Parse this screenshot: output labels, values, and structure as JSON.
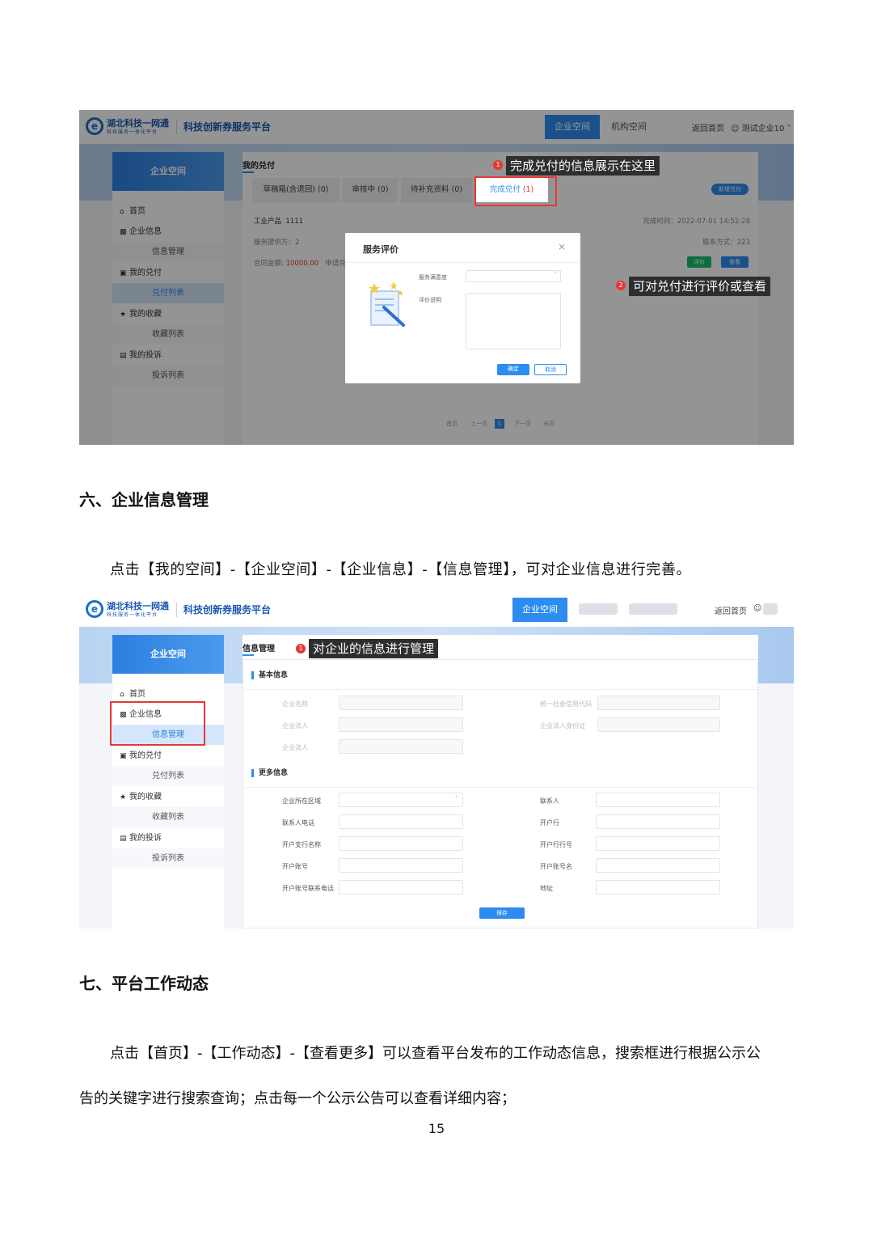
{
  "screenshot1": {
    "logo_title": "湖北科技一网通",
    "logo_sub": "科技服务一体化平台",
    "platform_title": "科技创新券服务平台",
    "top_tabs": [
      "企业空间",
      "机构空间"
    ],
    "top_links": [
      "返回首页",
      "测试企业10"
    ],
    "sidebar": {
      "head": "企业空间",
      "items": [
        {
          "label": "首页",
          "icon": "home-icon"
        },
        {
          "label": "企业信息",
          "icon": "chart-icon"
        },
        {
          "label": "信息管理",
          "sub": true
        },
        {
          "label": "我的兑付",
          "icon": "square-icon"
        },
        {
          "label": "兑付列表",
          "sub": true
        },
        {
          "label": "我的收藏",
          "icon": "star-icon"
        },
        {
          "label": "收藏列表",
          "sub": true
        },
        {
          "label": "我的投诉",
          "icon": "doc-icon"
        },
        {
          "label": "投诉列表",
          "sub": true
        }
      ]
    },
    "page_title": "我的兑付",
    "tabs": [
      "草稿箱(含退回)",
      "审核中",
      "待补充资料",
      "完成兑付"
    ],
    "tab_counts": [
      "(0)",
      "(0)",
      "(0)",
      "(1)"
    ],
    "new_button": "新增兑付",
    "record": {
      "product_label": "工业产品",
      "product_value": "1111",
      "provider": "服务提供方：2",
      "amount_label": "合同金额:",
      "amount_value": "10000.00",
      "apply_label": "申请兑",
      "time": "完成时间：2022-07-01 14:52:28",
      "contact": "联系方式：223",
      "btn_rate": "评价",
      "btn_view": "查看"
    },
    "pager": [
      "首页",
      "上一页",
      "1",
      "下一页",
      "末页"
    ],
    "modal": {
      "title": "服务评价",
      "close": "×",
      "label_satisfaction": "服务满意度",
      "label_desc": "评价说明",
      "confirm": "确定",
      "cancel": "取消"
    },
    "callouts": [
      {
        "badge": "1",
        "text": "完成兑付的信息展示在这里"
      },
      {
        "badge": "2",
        "text": "可对兑付进行评价或查看"
      }
    ]
  },
  "heading6": "六、企业信息管理",
  "para6": "点击【我的空间】-【企业空间】-【企业信息】-【信息管理】，可对企业信息进行完善。",
  "screenshot2": {
    "logo_title": "湖北科技一网通",
    "logo_sub": "科技服务一体化平台",
    "platform_title": "科技创新券服务平台",
    "top_tab": "企业空间",
    "top_link": "返回首页",
    "sidebar": {
      "head": "企业空间",
      "items": [
        {
          "label": "首页",
          "icon": "home-icon"
        },
        {
          "label": "企业信息",
          "icon": "chart-icon"
        },
        {
          "label": "信息管理",
          "sub": true
        },
        {
          "label": "我的兑付",
          "icon": "square-icon"
        },
        {
          "label": "兑付列表",
          "sub": true
        },
        {
          "label": "我的收藏",
          "icon": "star-icon"
        },
        {
          "label": "收藏列表",
          "sub": true
        },
        {
          "label": "我的投诉",
          "icon": "doc-icon"
        },
        {
          "label": "投诉列表",
          "sub": true
        }
      ]
    },
    "page_title": "信息管理",
    "callout": {
      "badge": "1",
      "text": "对企业的信息进行管理"
    },
    "basic_section": "基本信息",
    "basic_fields_left": [
      "企业名称",
      "企业法人",
      "企业法人"
    ],
    "basic_fields_right": [
      "统一社会信用代码",
      "企业法人身份证"
    ],
    "more_section": "更多信息",
    "more_fields_left": [
      "企业所在区域",
      "联系人电话",
      "开户支行名称",
      "开户账号",
      "开户账号联系电话"
    ],
    "more_fields_right": [
      "联系人",
      "开户行",
      "开户行行号",
      "开户账号名",
      "地址"
    ],
    "save": "保存"
  },
  "heading7": "七、平台工作动态",
  "para7_line1": "点击【首页】-【工作动态】-【查看更多】可以查看平台发布的工作动态信息，搜索框进行根据公示公",
  "para7_line2": "告的关键字进行搜索查询；点击每一个公示公告可以查看详细内容；",
  "page_number": "15",
  "colors": {
    "accent": "#2d8cf0",
    "highlight_red": "#e53935",
    "callout_bg": "#2e2e2e"
  }
}
